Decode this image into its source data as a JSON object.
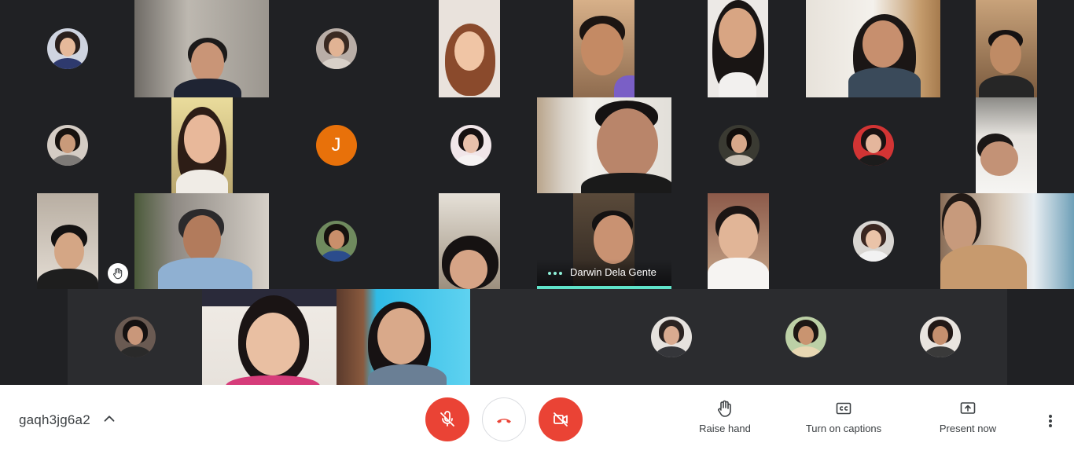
{
  "meeting": {
    "code": "gaqh3jg6a2"
  },
  "participants": {
    "speaking_name": "Darwin Dela Gente",
    "letter_avatar": "J"
  },
  "controls": {
    "raise_hand_label": "Raise hand",
    "captions_label": "Turn on captions",
    "present_label": "Present now",
    "mic_state": "muted",
    "camera_state": "off",
    "icons": {
      "mic": "mic-off-icon",
      "hangup": "hang-up-icon",
      "camera": "camera-off-icon",
      "raise_hand": "hand-icon",
      "captions": "closed-captions-icon",
      "present": "present-screen-icon",
      "more": "more-vert-icon",
      "chevron": "chevron-up-icon"
    }
  },
  "colors": {
    "background": "#202124",
    "red_button": "#ea4335",
    "speaking_accent": "#5fe3c9",
    "letter_avatar_bg": "#e8710a"
  }
}
